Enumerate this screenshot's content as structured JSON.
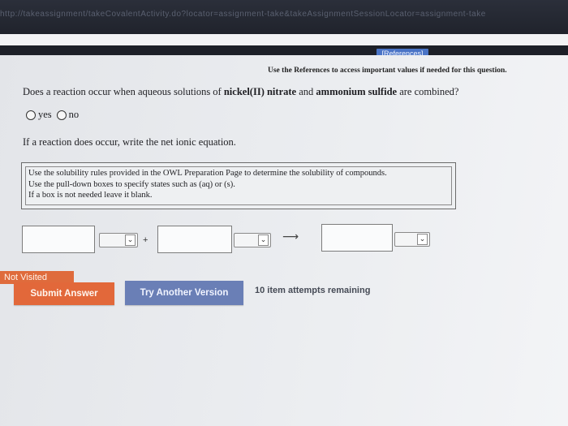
{
  "browser": {
    "url": "http://takeassignment/takeCovalentActivity.do?locator=assignment-take&takeAssignmentSessionLocator=assignment-take"
  },
  "header": {
    "references_button": "[References]",
    "use_references_text": "Use the References to access important values if needed for this question."
  },
  "question": {
    "prefix": "Does a reaction occur when aqueous solutions of ",
    "reactant1": "nickel(II) nitrate",
    "middle": " and ",
    "reactant2": "ammonium sulfide",
    "suffix": " are combined?",
    "options": [
      {
        "label": "yes"
      },
      {
        "label": "no"
      }
    ]
  },
  "prompt": "If a reaction does occur, write the net ionic equation.",
  "instructions": [
    "Use the solubility rules provided in the OWL Preparation Page to determine the solubility of compounds.",
    "Use the pull-down boxes to specify states such as (aq) or (s).",
    "If a box is not needed leave it blank."
  ],
  "equation": {
    "plus": "+",
    "arrow": "⟶",
    "dropdown_icon": "chevron-down-icon"
  },
  "status": {
    "not_visited": "Not Visited"
  },
  "actions": {
    "submit_label": "Submit Answer",
    "try_another_label": "Try Another Version",
    "attempts_text": "10 item attempts remaining"
  },
  "colors": {
    "submit": "#e2683a",
    "try_another": "#6a7fb6",
    "references": "#4a74c6"
  }
}
